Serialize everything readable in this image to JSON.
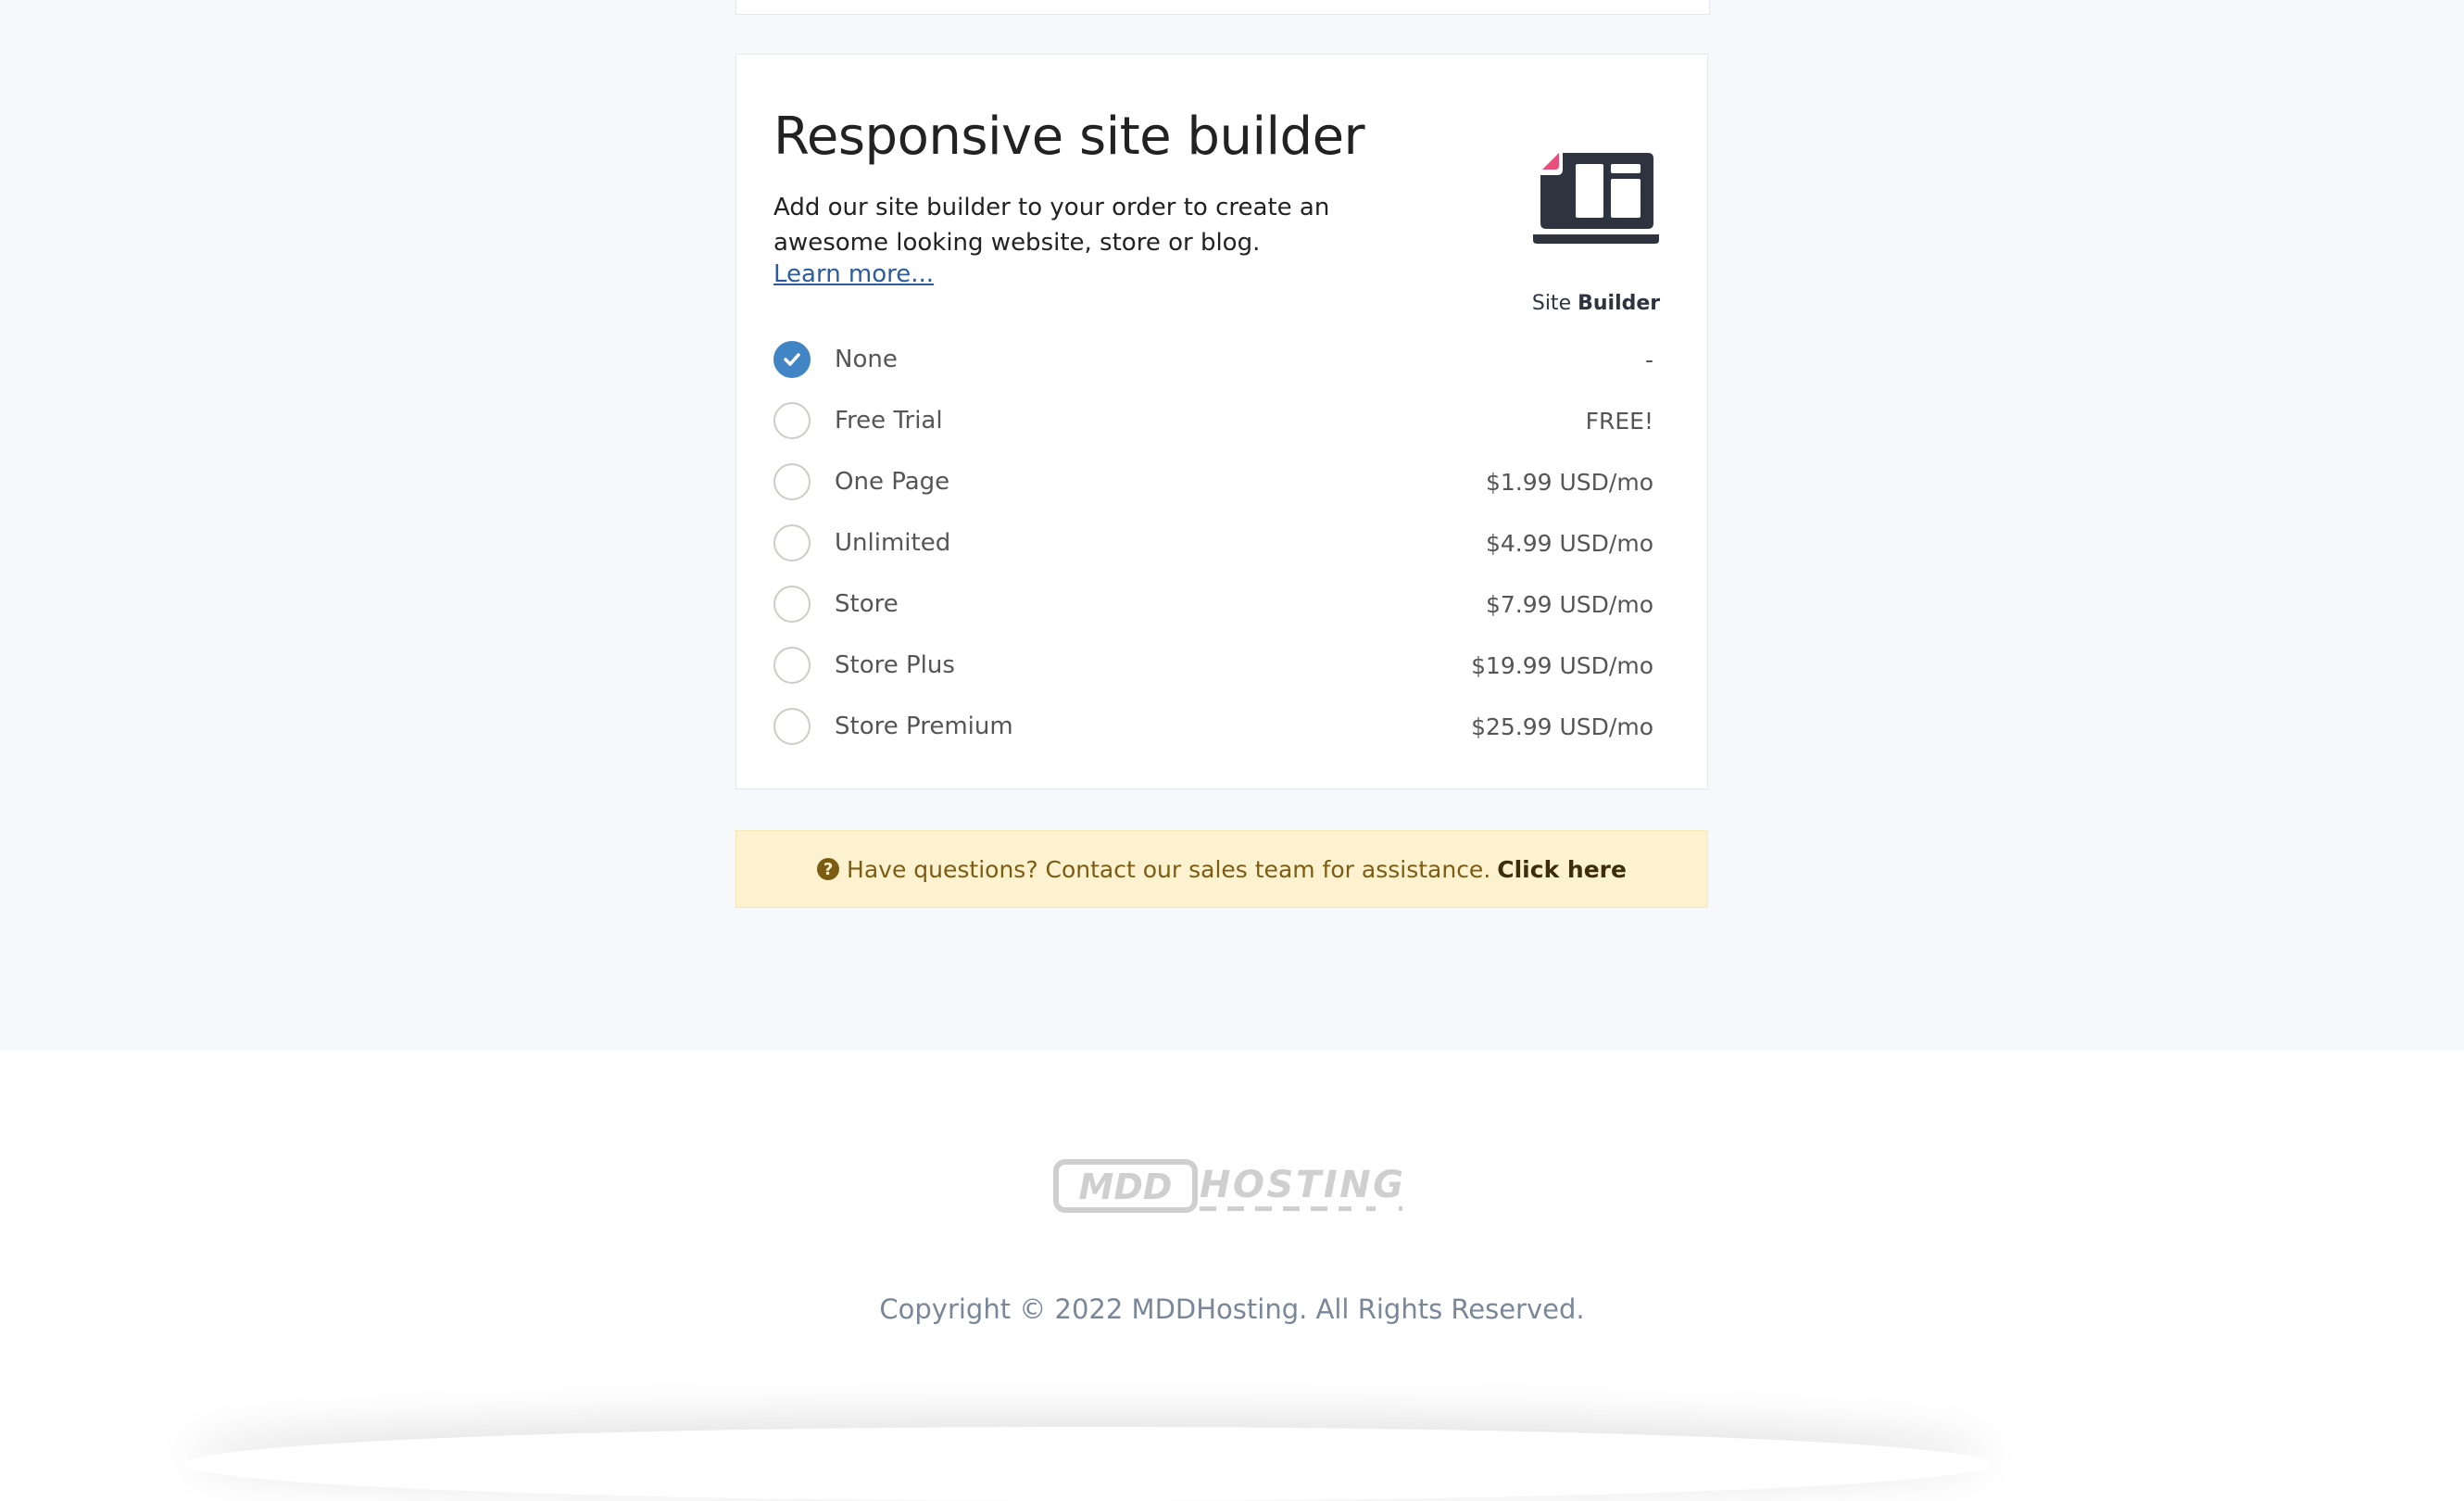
{
  "site_builder": {
    "title": "Responsive site builder",
    "description": "Add our site builder to your order to create an awesome looking website, store or blog.",
    "learn_more": "Learn more...",
    "logo_text_light": "Site",
    "logo_text_bold": "Builder",
    "accent_color": "#4285c4",
    "selected": "None",
    "options": [
      {
        "label": "None",
        "price": "-",
        "checked": true
      },
      {
        "label": "Free Trial",
        "price": "FREE!",
        "checked": false
      },
      {
        "label": "One Page",
        "price": "$1.99 USD/mo",
        "checked": false
      },
      {
        "label": "Unlimited",
        "price": "$4.99 USD/mo",
        "checked": false
      },
      {
        "label": "Store",
        "price": "$7.99 USD/mo",
        "checked": false
      },
      {
        "label": "Store Plus",
        "price": "$19.99 USD/mo",
        "checked": false
      },
      {
        "label": "Store Premium",
        "price": "$25.99 USD/mo",
        "checked": false
      }
    ]
  },
  "alert": {
    "icon": "question-circle-icon",
    "text": "Have questions? Contact our sales team for assistance.",
    "link": "Click here"
  },
  "footer": {
    "logo_text": "MDDHOSTING",
    "copyright": "Copyright © 2022 MDDHosting. All Rights Reserved."
  }
}
